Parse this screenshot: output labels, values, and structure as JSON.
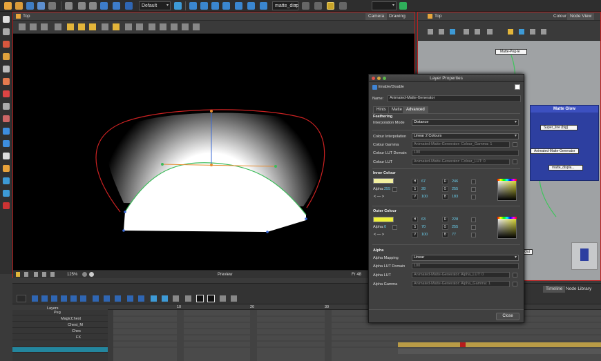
{
  "toolbar": {
    "preset_value": "Default",
    "view_value": "matte_disp"
  },
  "camera_view": {
    "title": "Top",
    "tabs": [
      "Camera",
      "Drawing"
    ],
    "status_zoom": "125%",
    "status_mode": "Preview",
    "status_frame": "Fr 48"
  },
  "right_panel": {
    "title": "Top",
    "tabs": [
      "Colour",
      "Node View"
    ],
    "nodes": {
      "top_node": "Matte-Peg-le",
      "group_title": "Matte Glow",
      "node_1": "Super_line (big)",
      "node_2": "Animated-Matte-Generator",
      "node_3": "matte_displa...",
      "node_out": "Out"
    }
  },
  "timeline": {
    "tabs": [
      "Timeline",
      "Node Library"
    ],
    "layers_header": "Layers",
    "frame_numbers": [
      "10",
      "20",
      "30"
    ],
    "layers": [
      {
        "name": "Peg"
      },
      {
        "name": "MagicChest"
      },
      {
        "name": "Chest_M"
      },
      {
        "name": "Ches"
      },
      {
        "name": "FX"
      },
      {
        "name": ""
      },
      {
        "name": ""
      }
    ]
  },
  "dialog": {
    "title": "Layer Properties",
    "enable_label": "Enable/Disable",
    "name_label": "Name:",
    "name_value": "Animated-Matte-Generator",
    "tabs": [
      "Hints",
      "Matte",
      "Advanced"
    ],
    "feathering": {
      "section": "Feathering",
      "interp_label": "Interpolation Mode",
      "interp_value": "Distance"
    },
    "colour": {
      "interp_label": "Colour Interpolation",
      "interp_value": "Linear 2 Colours",
      "gamma_label": "Colour Gamma",
      "gamma_value": "Animated-Matte-Generator: Colour_Gamma: 1",
      "lut_domain_label": "Colour LUT Domain",
      "lut_domain_value": "100",
      "lut_label": "Colour LUT",
      "lut_value": "Animated-Matte-Generator: Colour_LUT: 0"
    },
    "inner_colour": {
      "section": "Inner Colour",
      "swatch": "#f2f0a0",
      "alpha_label": "Alpha:",
      "alpha_value": "255",
      "h_label": "H",
      "h": "67",
      "s_label": "S",
      "s": "28",
      "v_label": "V",
      "v": "100",
      "r_label": "R",
      "r": "246",
      "g_label": "G",
      "g": "255",
      "b_label": "B",
      "b": "183"
    },
    "outer_colour": {
      "section": "Outer Colour",
      "swatch": "#eef03a",
      "alpha_label": "Alpha:",
      "alpha_value": "0",
      "h_label": "H",
      "h": "63",
      "s_label": "S",
      "s": "70",
      "v_label": "V",
      "v": "100",
      "r_label": "R",
      "r": "228",
      "g_label": "G",
      "g": "255",
      "b_label": "B",
      "b": "77"
    },
    "alpha": {
      "section": "Alpha",
      "mapping_label": "Alpha Mapping",
      "mapping_value": "Linear",
      "lut_domain_label": "Alpha LUT Domain",
      "lut_domain_value": "100",
      "lut_label": "Alpha LUT",
      "lut_value": "Animated-Matte-Generator: Alpha_LUT: 0",
      "gamma_label": "Alpha Gamma",
      "gamma_value": "Animated-Matte-Generator: Alpha_Gamma: 1"
    },
    "close_label": "Close"
  }
}
